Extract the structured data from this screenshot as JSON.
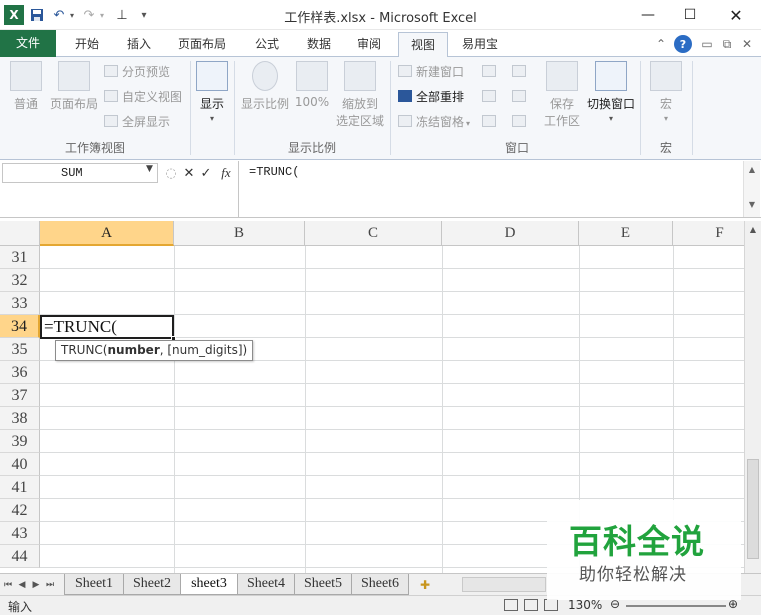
{
  "titlebar": {
    "title": "工作样表.xlsx - Microsoft Excel",
    "save_icon": "save-icon",
    "undo_icon": "undo-icon",
    "redo_icon": "redo-icon"
  },
  "ribbon_tabs": [
    "文件",
    "开始",
    "插入",
    "页面布局",
    "公式",
    "数据",
    "审阅",
    "视图",
    "易用宝"
  ],
  "active_tab": "视图",
  "ribbon": {
    "workbook_views": {
      "label": "工作簿视图",
      "normal": "普通",
      "page_layout": "页面布局",
      "page_break_preview": "分页预览",
      "custom_views": "自定义视图",
      "full_screen": "全屏显示"
    },
    "show": {
      "label": "显示"
    },
    "zoom": {
      "label": "显示比例",
      "zoom": "显示比例",
      "hundred": "100%",
      "zoom_to_selection": [
        "缩放到",
        "选定区域"
      ]
    },
    "window": {
      "label": "窗口",
      "new_window": "新建窗口",
      "arrange_all": "全部重排",
      "freeze_panes": "冻结窗格",
      "save_workspace": [
        "保存",
        "工作区"
      ],
      "switch_windows": "切换窗口"
    },
    "macros": {
      "label": "宏",
      "macros": "宏"
    }
  },
  "formula_bar": {
    "name_box": "SUM",
    "formula": "=TRUNC("
  },
  "grid": {
    "columns": [
      "A",
      "B",
      "C",
      "D",
      "E",
      "F"
    ],
    "selected_column": "A",
    "rows": [
      "31",
      "32",
      "33",
      "34",
      "35",
      "36",
      "37",
      "38",
      "39",
      "40",
      "41",
      "42",
      "43",
      "44"
    ],
    "selected_row": "34",
    "active_cell_text": "=TRUNC(",
    "tooltip": {
      "func": "TRUNC(",
      "arg_bold": "number",
      "rest": ", [num_digits])"
    }
  },
  "sheets": [
    "Sheet1",
    "Sheet2",
    "sheet3",
    "Sheet4",
    "Sheet5",
    "Sheet6"
  ],
  "active_sheet": "sheet3",
  "status": {
    "mode": "输入",
    "zoom": "130%"
  },
  "watermark": {
    "logo": "百科全说",
    "sub": "助你轻松解决"
  },
  "colors": {
    "file_tab": "#217346",
    "selected_header": "#ffd58a",
    "watermark_green": "#21a33d"
  }
}
